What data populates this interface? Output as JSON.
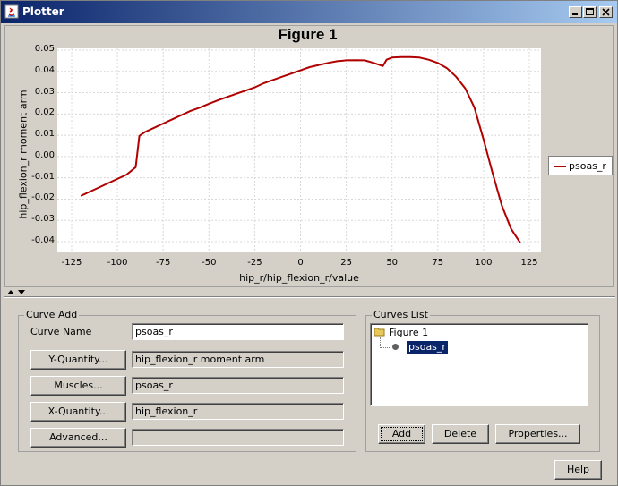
{
  "window": {
    "title": "Plotter"
  },
  "figure": {
    "title": "Figure 1"
  },
  "chart_data": {
    "type": "line",
    "title": "Figure 1",
    "xlabel": "hip_r/hip_flexion_r/value",
    "ylabel": "hip_flexion_r moment arm",
    "xlim": [
      -130,
      130
    ],
    "ylim": [
      -0.045,
      0.05
    ],
    "x_ticks": [
      "-125",
      "-100",
      "-75",
      "-50",
      "-25",
      "0",
      "25",
      "50",
      "75",
      "100",
      "125"
    ],
    "y_ticks": [
      "0.05",
      "0.04",
      "0.03",
      "0.02",
      "0.01",
      "0.00",
      "-0.01",
      "-0.02",
      "-0.03",
      "-0.04"
    ],
    "grid": true,
    "legend_placement": "right",
    "series": [
      {
        "name": "psoas_r",
        "color": "#b10000",
        "x": [
          -120,
          -115,
          -110,
          -105,
          -100,
          -95,
          -90,
          -88,
          -85,
          -80,
          -75,
          -70,
          -65,
          -60,
          -55,
          -50,
          -45,
          -40,
          -35,
          -30,
          -25,
          -20,
          -15,
          -10,
          -5,
          0,
          5,
          10,
          15,
          20,
          25,
          30,
          35,
          40,
          45,
          47,
          50,
          55,
          60,
          65,
          70,
          75,
          80,
          85,
          90,
          95,
          100,
          105,
          110,
          115,
          120
        ],
        "y": [
          -0.0185,
          -0.0165,
          -0.0145,
          -0.0125,
          -0.0105,
          -0.0085,
          -0.005,
          0.0097,
          0.0115,
          0.0135,
          0.0155,
          0.0175,
          0.0195,
          0.0215,
          0.023,
          0.0248,
          0.0265,
          0.028,
          0.0295,
          0.031,
          0.0325,
          0.0345,
          0.036,
          0.0375,
          0.039,
          0.0405,
          0.042,
          0.043,
          0.044,
          0.0448,
          0.0452,
          0.0453,
          0.0452,
          0.044,
          0.0425,
          0.0455,
          0.0465,
          0.0467,
          0.0467,
          0.0465,
          0.0455,
          0.044,
          0.0415,
          0.0375,
          0.032,
          0.023,
          0.008,
          -0.008,
          -0.023,
          -0.034,
          -0.0405
        ]
      }
    ]
  },
  "legend": {
    "label": "psoas_r"
  },
  "curve_add": {
    "group_label": "Curve Add",
    "curve_name_label": "Curve Name",
    "curve_name_value": "psoas_r",
    "y_quantity_button": "Y-Quantity...",
    "y_quantity_value": "hip_flexion_r moment arm",
    "muscles_button": "Muscles...",
    "muscles_value": "psoas_r",
    "x_quantity_button": "X-Quantity...",
    "x_quantity_value": "hip_flexion_r",
    "advanced_button": "Advanced...",
    "advanced_value": ""
  },
  "curves_list": {
    "group_label": "Curves List",
    "root": "Figure 1",
    "items": [
      "psoas_r"
    ],
    "add_button": "Add",
    "delete_button": "Delete",
    "properties_button": "Properties..."
  },
  "help_button": "Help",
  "colors": {
    "titlebar_start": "#0a246a",
    "titlebar_end": "#a6caf0",
    "curve": "#b10000",
    "selection": "#0a246a"
  }
}
